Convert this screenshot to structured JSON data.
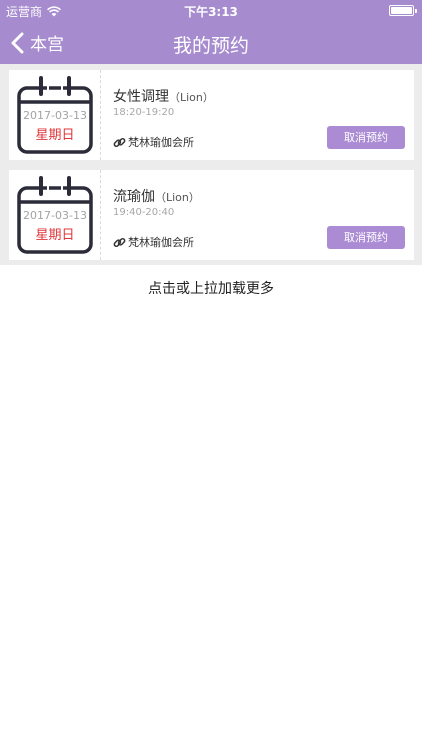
{
  "status_bar": {
    "carrier": "运营商",
    "time": "下午3:13"
  },
  "nav": {
    "back_label": "本宫",
    "title": "我的预约"
  },
  "bookings": [
    {
      "date": "2017-03-13",
      "weekday": "星期日",
      "course": "女性调理",
      "teacher": "（Lion）",
      "time_range": "18:20-19:20",
      "venue": "梵林瑜伽会所",
      "cancel_label": "取消预约"
    },
    {
      "date": "2017-03-13",
      "weekday": "星期日",
      "course": "流瑜伽",
      "teacher": "（Lion）",
      "time_range": "19:40-20:40",
      "venue": "梵林瑜伽会所",
      "cancel_label": "取消预约"
    }
  ],
  "load_more": "点击或上拉加载更多",
  "colors": {
    "header": "#a68bcf",
    "button": "#ab8cd4",
    "weekday": "#e0353a"
  }
}
